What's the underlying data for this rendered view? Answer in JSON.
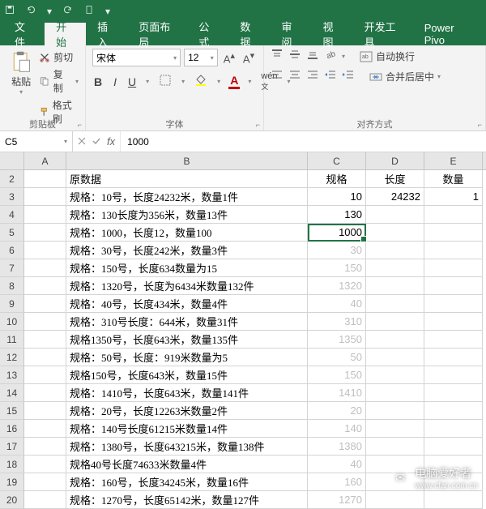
{
  "qat": {
    "save": "保存",
    "undo": "撤销",
    "redo": "重做"
  },
  "tabs": {
    "file": "文件",
    "home": "开始",
    "insert": "插入",
    "layout": "页面布局",
    "formulas": "公式",
    "data": "数据",
    "review": "审阅",
    "view": "视图",
    "developer": "开发工具",
    "powerpivot": "Power Pivo"
  },
  "ribbon": {
    "clipboard": {
      "paste": "粘贴",
      "cut": "剪切",
      "copy": "复制",
      "format_painter": "格式刷",
      "group": "剪贴板"
    },
    "font": {
      "name": "宋体",
      "size": "12",
      "group": "字体",
      "bold": "B",
      "italic": "I",
      "underline": "U"
    },
    "align": {
      "wrap": "自动换行",
      "merge": "合并后居中",
      "group": "对齐方式"
    }
  },
  "namebox": "C5",
  "formula": "1000",
  "columns": [
    "A",
    "B",
    "C",
    "D",
    "E"
  ],
  "row_numbers": [
    "2",
    "3",
    "4",
    "5",
    "6",
    "7",
    "8",
    "9",
    "10",
    "11",
    "12",
    "13",
    "14",
    "15",
    "16",
    "17",
    "18",
    "19",
    "20"
  ],
  "header_row": {
    "b": "原数据",
    "c": "规格",
    "d": "长度",
    "e": "数量"
  },
  "rows": [
    {
      "b": "规格：10号，长度24232米，数量1件",
      "c": "10",
      "d": "24232",
      "e": "1",
      "ghost": false
    },
    {
      "b": "规格：130长度为356米，数量13件",
      "c": "130",
      "d": "",
      "e": "",
      "ghost": false
    },
    {
      "b": "规格：1000，长度12，数量100",
      "c": "1000",
      "d": "",
      "e": "",
      "ghost": false
    },
    {
      "b": "规格：30号，长度242米，数量3件",
      "c": "30",
      "d": "",
      "e": "",
      "ghost": true
    },
    {
      "b": "规格：150号，长度634数量为15",
      "c": "150",
      "d": "",
      "e": "",
      "ghost": true
    },
    {
      "b": "规格：1320号，长度为6434米数量132件",
      "c": "1320",
      "d": "",
      "e": "",
      "ghost": true
    },
    {
      "b": "规格：40号，长度434米，数量4件",
      "c": "40",
      "d": "",
      "e": "",
      "ghost": true
    },
    {
      "b": "规格：310号长度：644米，数量31件",
      "c": "310",
      "d": "",
      "e": "",
      "ghost": true
    },
    {
      "b": "规格1350号，长度643米，数量135件",
      "c": "1350",
      "d": "",
      "e": "",
      "ghost": true
    },
    {
      "b": "规格：50号，长度：919米数量为5",
      "c": "50",
      "d": "",
      "e": "",
      "ghost": true
    },
    {
      "b": "规格150号，长度643米，数量15件",
      "c": "150",
      "d": "",
      "e": "",
      "ghost": true
    },
    {
      "b": "规格：1410号，长度643米，数量141件",
      "c": "1410",
      "d": "",
      "e": "",
      "ghost": true
    },
    {
      "b": "规格：20号，长度12263米数量2件",
      "c": "20",
      "d": "",
      "e": "",
      "ghost": true
    },
    {
      "b": "规格：140号长度61215米数量14件",
      "c": "140",
      "d": "",
      "e": "",
      "ghost": true
    },
    {
      "b": "规格：1380号，长度643215米，数量138件",
      "c": "1380",
      "d": "",
      "e": "",
      "ghost": true
    },
    {
      "b": "规格40号长度74633米数量4件",
      "c": "40",
      "d": "",
      "e": "",
      "ghost": true
    },
    {
      "b": "规格：160号，长度34245米，数量16件",
      "c": "160",
      "d": "",
      "e": "",
      "ghost": true
    },
    {
      "b": "规格：1270号，长度65142米，数量127件",
      "c": "1270",
      "d": "",
      "e": "",
      "ghost": true
    }
  ],
  "watermark": {
    "title": "电脑爱好者",
    "url": "www.cfan.com.cn"
  }
}
